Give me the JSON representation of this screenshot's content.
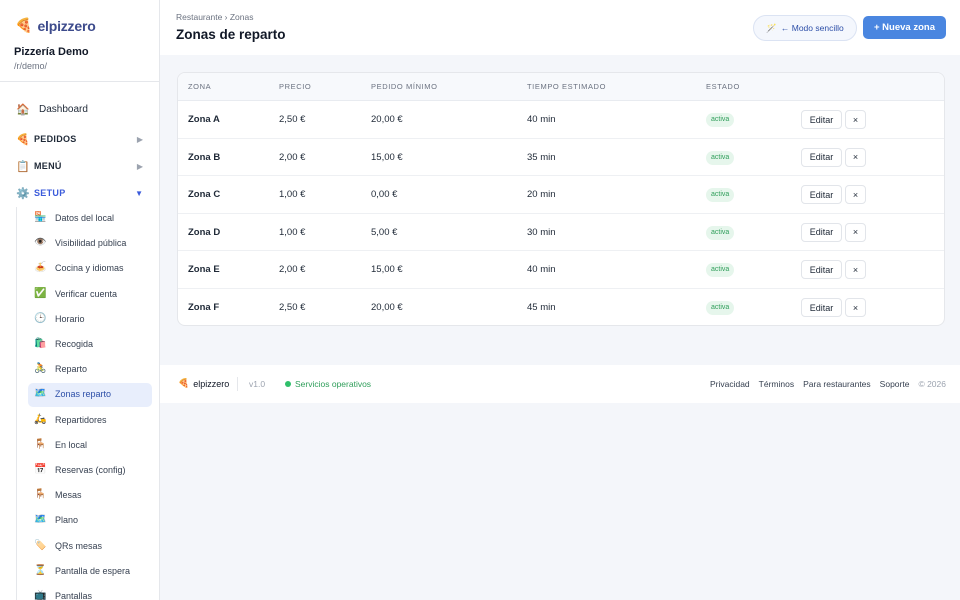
{
  "brand": {
    "name": "elpizzero",
    "icon": "🍕"
  },
  "restaurant": {
    "name": "Pizzería Demo",
    "slug": "/r/demo/"
  },
  "nav": {
    "dashboard": {
      "label": "Dashboard",
      "icon": "🏠"
    },
    "pedidos": {
      "label": "PEDIDOS",
      "icon": "🍕",
      "arrow": "▶"
    },
    "menu": {
      "label": "MENÚ",
      "icon": "📋",
      "arrow": "▶"
    },
    "setup": {
      "label": "SETUP",
      "icon": "⚙️",
      "arrow": "▼"
    }
  },
  "setup_items": [
    {
      "label": "Datos del local",
      "icon": "🏪"
    },
    {
      "label": "Visibilidad pública",
      "icon": "👁️"
    },
    {
      "label": "Cocina y idiomas",
      "icon": "🍝"
    },
    {
      "label": "Verificar cuenta",
      "icon": "✅"
    },
    {
      "label": "Horario",
      "icon": "🕒"
    },
    {
      "label": "Recogida",
      "icon": "🛍️"
    },
    {
      "label": "Reparto",
      "icon": "🚴"
    },
    {
      "label": "Zonas reparto",
      "icon": "🗺️",
      "active": true
    },
    {
      "label": "Repartidores",
      "icon": "🛵"
    },
    {
      "label": "En local",
      "icon": "🪑"
    },
    {
      "label": "Reservas (config)",
      "icon": "📅"
    },
    {
      "label": "Mesas",
      "icon": "🪑"
    },
    {
      "label": "Plano",
      "icon": "🗺️"
    },
    {
      "label": "QRs mesas",
      "icon": "🏷️"
    },
    {
      "label": "Pantalla de espera",
      "icon": "⏳"
    },
    {
      "label": "Pantallas",
      "icon": "📺"
    }
  ],
  "header": {
    "breadcrumb": "Restaurante › Zonas",
    "title": "Zonas de reparto",
    "mode_button": {
      "icon": "🪄",
      "label": "← Modo sencillo"
    },
    "new_button": "+ Nueva zona"
  },
  "table": {
    "columns": [
      "ZONA",
      "PRECIO",
      "PEDIDO MÍNIMO",
      "TIEMPO ESTIMADO",
      "ESTADO"
    ],
    "edit_label": "Editar",
    "delete_label": "×",
    "rows": [
      {
        "zone": "Zona A",
        "price": "2,50 €",
        "min_order": "20,00 €",
        "time": "40 min",
        "status": "activa"
      },
      {
        "zone": "Zona B",
        "price": "2,00 €",
        "min_order": "15,00 €",
        "time": "35 min",
        "status": "activa"
      },
      {
        "zone": "Zona C",
        "price": "1,00 €",
        "min_order": "0,00 €",
        "time": "20 min",
        "status": "activa"
      },
      {
        "zone": "Zona D",
        "price": "1,00 €",
        "min_order": "5,00 €",
        "time": "30 min",
        "status": "activa"
      },
      {
        "zone": "Zona E",
        "price": "2,00 €",
        "min_order": "15,00 €",
        "time": "40 min",
        "status": "activa"
      },
      {
        "zone": "Zona F",
        "price": "2,50 €",
        "min_order": "20,00 €",
        "time": "45 min",
        "status": "activa"
      }
    ]
  },
  "footer": {
    "brand": "elpizzero",
    "version": "v1.0",
    "status": "Servicios operativos",
    "links": [
      "Privacidad",
      "Términos",
      "Para restaurantes",
      "Soporte"
    ],
    "copyright": "© 2026"
  },
  "colors": {
    "accent": "#4a86e0",
    "active_bg": "#e8eefc",
    "status_green": "#2f9e5a"
  }
}
